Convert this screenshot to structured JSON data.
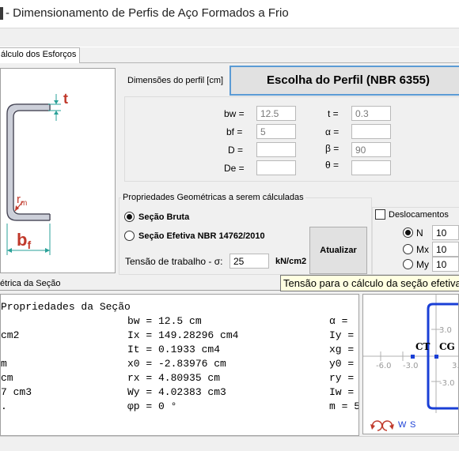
{
  "window": {
    "title": "- Dimensionamento de Perfis de Aço Formados a Frio"
  },
  "tabs": [
    {
      "label": "álculo dos Esforços"
    }
  ],
  "drawing": {
    "t_label": "t",
    "rm_label": "r",
    "rm_sub": "m",
    "bf_label": "b",
    "bf_sub": "f"
  },
  "dimensions": {
    "label": "Dimensões do perfil [cm]",
    "choose_button": "Escolha do Perfil (NBR 6355)",
    "fields": {
      "bw": {
        "label": "bw =",
        "value": "12.5"
      },
      "bf": {
        "label": "bf =",
        "value": "5"
      },
      "D": {
        "label": "D =",
        "value": ""
      },
      "De": {
        "label": "De =",
        "value": ""
      },
      "t": {
        "label": "t =",
        "value": "0.3"
      },
      "alpha": {
        "label": "α =",
        "value": ""
      },
      "beta": {
        "label": "β =",
        "value": "90"
      },
      "theta": {
        "label": "θ =",
        "value": ""
      }
    }
  },
  "geom_props": {
    "legend": "Propriedades Geométricas a serem cálculadas",
    "secao_bruta": {
      "label": "Seção Bruta",
      "selected": true
    },
    "secao_efetiva": {
      "label": "Seção Efetiva NBR 14762/2010",
      "selected": false
    },
    "tensao_label": "Tensão de trabalho - σ:",
    "tensao_value": "25",
    "tensao_unit": "kN/cm2",
    "update_button": "Atualizar"
  },
  "deslocamentos": {
    "label": "Deslocamentos",
    "checked": false,
    "items": [
      {
        "label": "N",
        "value": "10",
        "selected": true
      },
      {
        "label": "Mx",
        "value": "10",
        "selected": false
      },
      {
        "label": "My",
        "value": "10",
        "selected": false
      }
    ]
  },
  "tooltip": "Tensão para o cálculo da seção efetiva",
  "section_header": "étrica da Seção",
  "properties": {
    "header": "Propriedades da Seção",
    "rows": [
      [
        "",
        "bw = 12.5 cm",
        "α ="
      ],
      [
        "cm2",
        "Ix = 149.28296 cm4",
        "Iy ="
      ],
      [
        "",
        "It = 0.1933 cm4",
        "xg ="
      ],
      [
        "m",
        "x0 = -2.83976 cm",
        "y0 ="
      ],
      [
        " cm",
        "rx = 4.80935 cm",
        "ry ="
      ],
      [
        "7 cm3",
        "Wy = 4.02383 cm3",
        "Iw ="
      ],
      [
        ".",
        "φp = 0 °",
        "m = 5"
      ]
    ]
  },
  "plot": {
    "ct_label": "CT",
    "cg_label": "CG",
    "ticks": {
      "x_neg6": "-6.0",
      "x_neg3": "-3.0",
      "x_pos3": "3.",
      "y_pos3": "3.0",
      "y_neg3": "-3.0"
    },
    "controls": {
      "w": "W",
      "s": "S"
    }
  }
}
